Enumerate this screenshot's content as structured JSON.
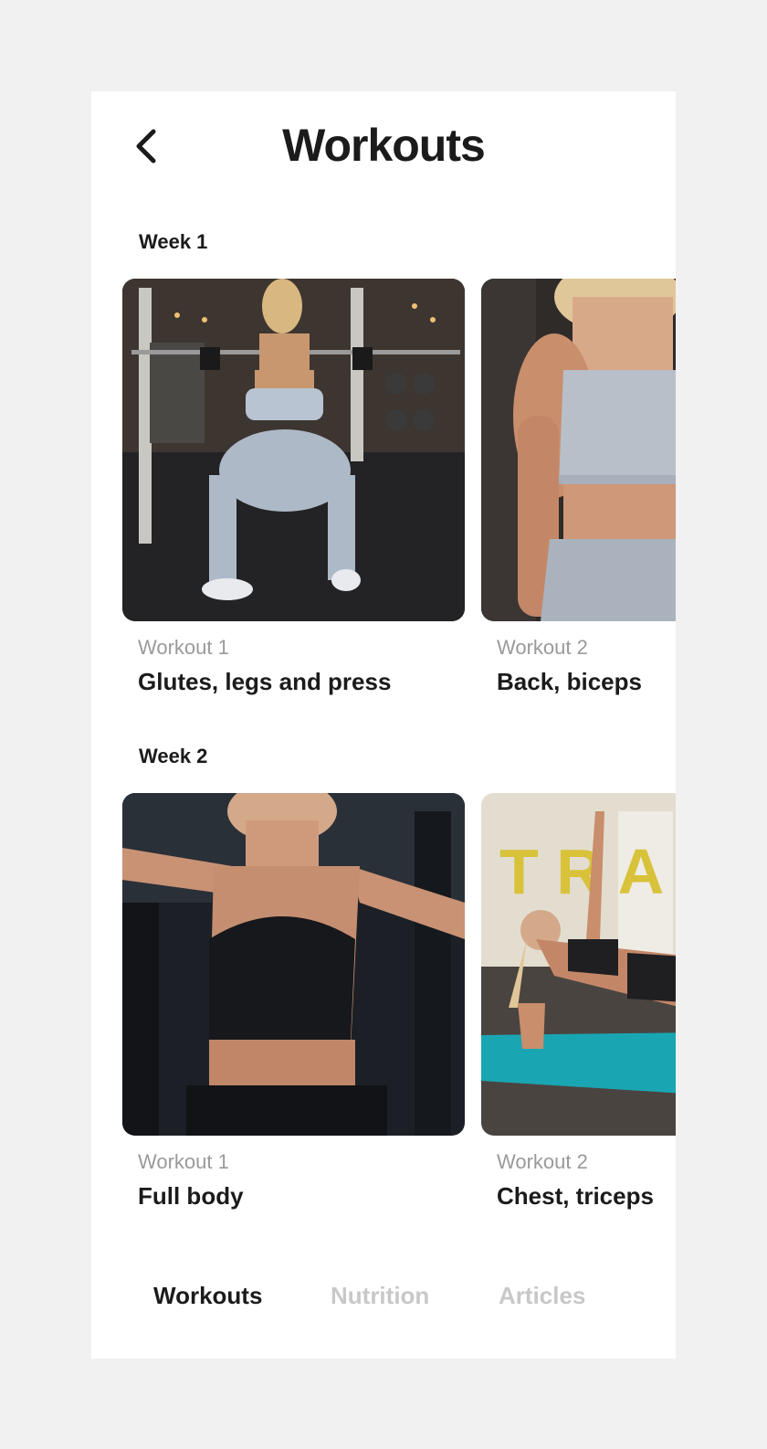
{
  "header": {
    "title": "Workouts",
    "back_icon": "chevron-left-icon"
  },
  "weeks": [
    {
      "title": "Week 1",
      "cards": [
        {
          "subtitle": "Workout 1",
          "title": "Glutes, legs and press"
        },
        {
          "subtitle": "Workout 2",
          "title": "Back, biceps"
        }
      ]
    },
    {
      "title": "Week 2",
      "cards": [
        {
          "subtitle": "Workout 1",
          "title": "Full body"
        },
        {
          "subtitle": "Workout 2",
          "title": "Chest, triceps"
        }
      ]
    }
  ],
  "tabs": [
    {
      "label": "Workouts",
      "active": true
    },
    {
      "label": "Nutrition",
      "active": false
    },
    {
      "label": "Articles",
      "active": false
    }
  ],
  "colors": {
    "background": "#f1f1f1",
    "surface": "#ffffff",
    "text_primary": "#1b1b1b",
    "text_secondary": "#9a9a9a",
    "tab_inactive": "#c8c8c8",
    "mat_accent": "#1aa5b3"
  }
}
